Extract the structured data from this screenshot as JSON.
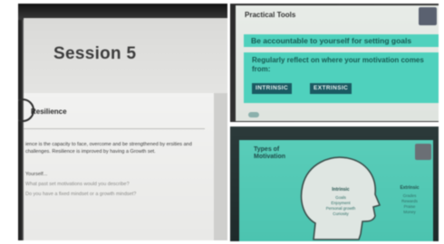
{
  "left_photo": {
    "session_title": "Session 5",
    "section_label": "Resilience",
    "paragraph": "ience is the capacity to face, overcome and be strengthened by ersities and challenges. Resilience is improved by having a Growth set.",
    "line_1": "Yourself...",
    "question_1": "What past set motivations would you describe?",
    "question_2": "Do you have a fixed mindset or a growth mindset?"
  },
  "top_right_photo": {
    "title": "Practical Tools",
    "accountable_line": "Be accountable to yourself for setting goals",
    "reflect_line": "Regularly reflect on where your motivation comes from:",
    "pill_intrinsic": "INTRINSIC",
    "pill_extrinsic": "EXTRINSIC"
  },
  "bottom_right_photo": {
    "title_line_1": "Types of",
    "title_line_2": "Motivation",
    "left_heading": "Intrinsic",
    "left_items": [
      "Goals",
      "Enjoyment",
      "Personal growth",
      "Curiosity"
    ],
    "right_heading": "Extrinsic",
    "right_items": [
      "Grades",
      "Rewards",
      "Praise",
      "Money"
    ]
  }
}
